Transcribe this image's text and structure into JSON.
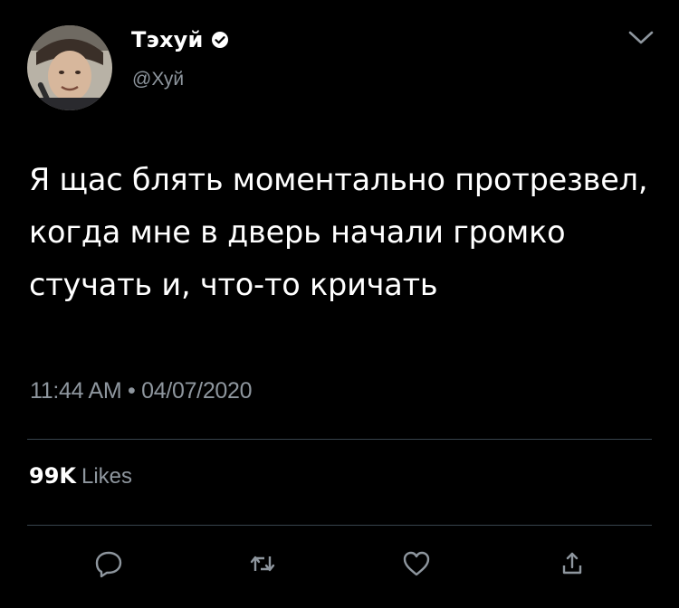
{
  "tweet": {
    "display_name": "Тэхуй",
    "handle": "@Хуй",
    "text": "Я щас блять моментально протрезвел, когда мне в дверь начали громко стучать и, что-то кричать",
    "timestamp": "11:44 AM • 04/07/2020",
    "likes_count": "99K",
    "likes_label": "Likes"
  },
  "icons": {
    "verified": "verified-badge-icon",
    "menu": "chevron-down-icon",
    "reply": "reply-icon",
    "retweet": "retweet-icon",
    "like": "heart-icon",
    "share": "share-icon"
  },
  "colors": {
    "background": "#000000",
    "primary_text": "#ffffff",
    "secondary_text": "#8e969e",
    "divider": "#38444d",
    "icon": "#8e969e"
  }
}
